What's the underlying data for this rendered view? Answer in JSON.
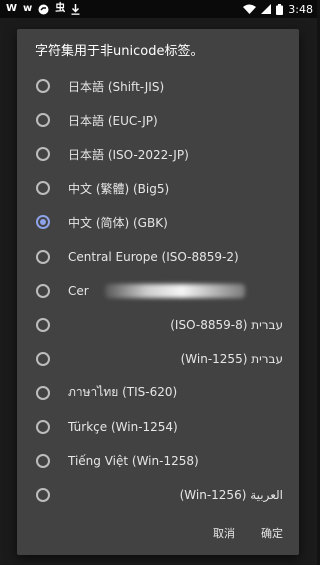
{
  "status_bar": {
    "time": "3:48",
    "left_icons": [
      "w-logo-icon",
      "w-logo-icon",
      "vpn-icon",
      "chinese-app-icon",
      "download-icon"
    ],
    "right_icons": [
      "wifi-icon",
      "signal-icon",
      "battery-icon"
    ]
  },
  "dialog": {
    "title": "字符集用于非unicode标签。",
    "options": [
      {
        "label": "日本語 (Shift-JIS)",
        "checked": false
      },
      {
        "label": "日本語 (EUC-JP)",
        "checked": false
      },
      {
        "label": "日本語 (ISO-2022-JP)",
        "checked": false
      },
      {
        "label": "中文 (繁體) (Big5)",
        "checked": false
      },
      {
        "label": "中文 (简体) (GBK)",
        "checked": true
      },
      {
        "label": "Central Europe (ISO-8859-2)",
        "checked": false
      },
      {
        "label": "Cer",
        "checked": false
      },
      {
        "label": "(ISO-8859-8) עברית",
        "checked": false
      },
      {
        "label": "(Win-1255) עברית",
        "checked": false
      },
      {
        "label": "ภาษาไทย (TIS-620)",
        "checked": false
      },
      {
        "label": "Türkçe (Win-1254)",
        "checked": false
      },
      {
        "label": "Tiếng Việt (Win-1258)",
        "checked": false
      },
      {
        "label": "(Win-1256) العربية",
        "checked": false
      }
    ],
    "cancel_label": "取消",
    "ok_label": "确定"
  },
  "colors": {
    "dialog_bg": "#424242",
    "accent": "#8ea2e8",
    "backdrop": "#1b1b1b"
  }
}
